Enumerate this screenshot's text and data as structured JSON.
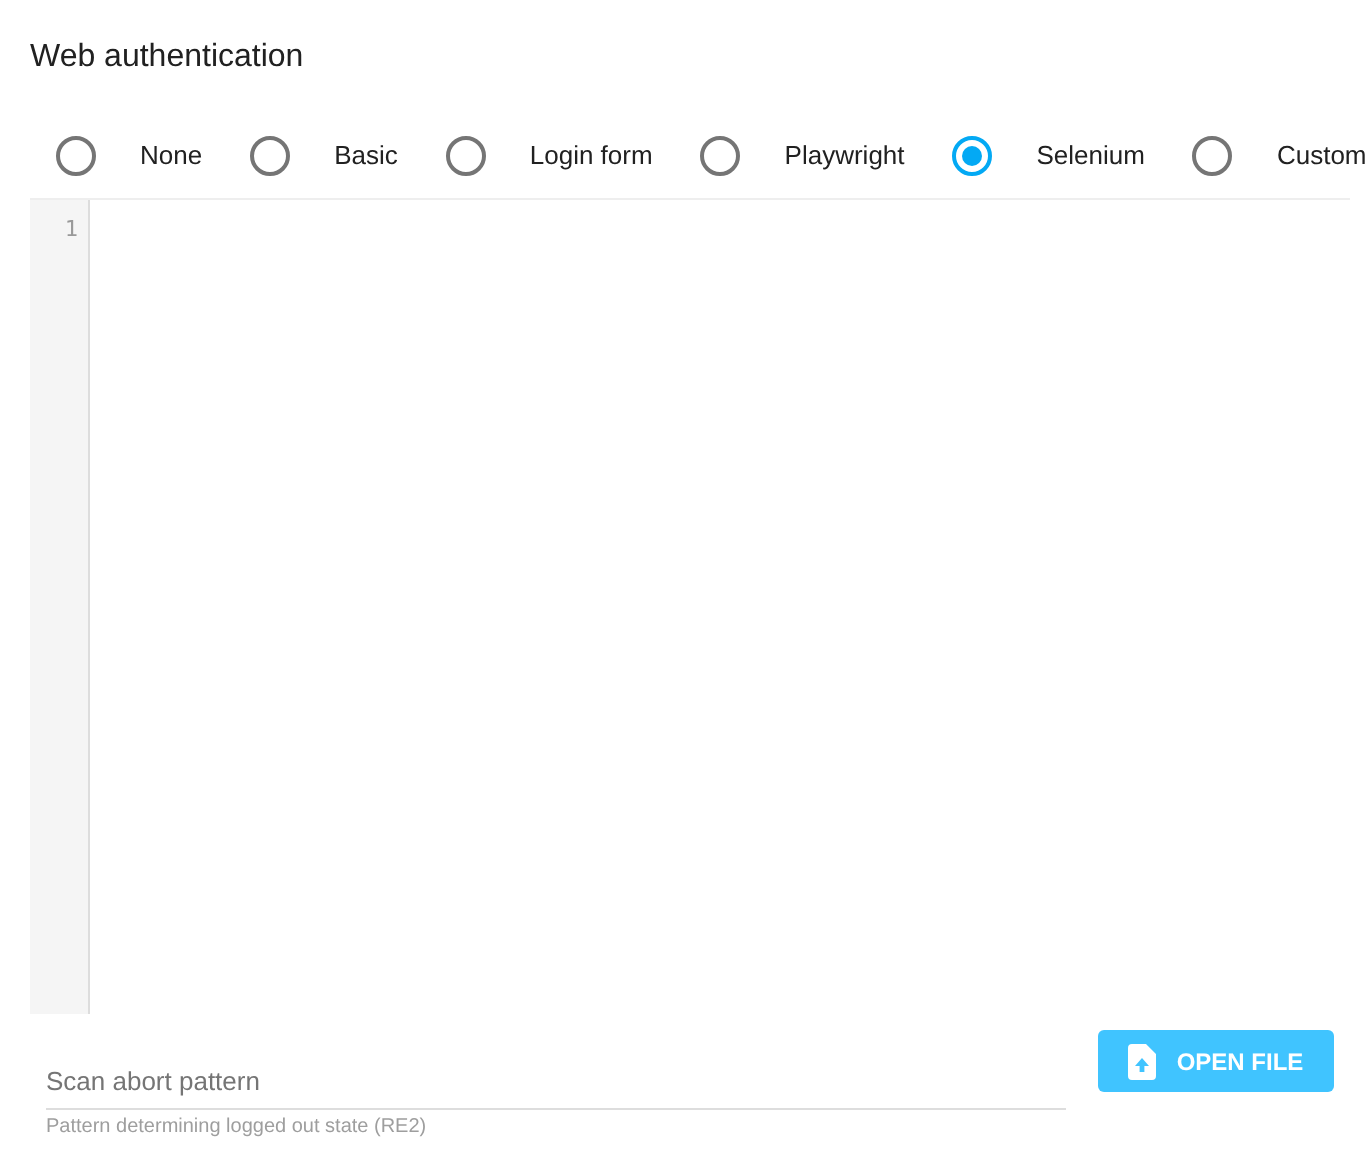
{
  "title": "Web authentication",
  "options": [
    {
      "label": "None",
      "selected": false
    },
    {
      "label": "Basic",
      "selected": false
    },
    {
      "label": "Login form",
      "selected": false
    },
    {
      "label": "Playwright",
      "selected": false
    },
    {
      "label": "Selenium",
      "selected": true
    },
    {
      "label": "Custom",
      "selected": false
    }
  ],
  "editor": {
    "line_numbers": [
      "1"
    ]
  },
  "pattern_field": {
    "placeholder": "Scan abort pattern",
    "helper": "Pattern determining logged out state (RE2)"
  },
  "open_button": {
    "label": "OPEN FILE"
  }
}
